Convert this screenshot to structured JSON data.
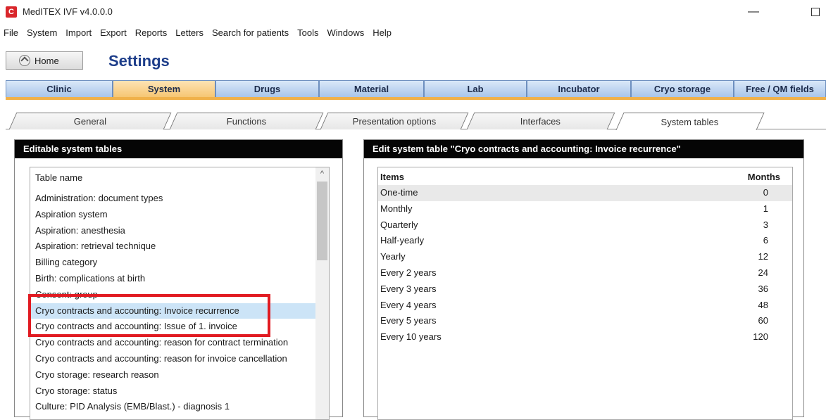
{
  "window": {
    "title": "MedITEX IVF v4.0.0.0",
    "app_icon": "meditex-logo-icon"
  },
  "menu": [
    "File",
    "System",
    "Import",
    "Export",
    "Reports",
    "Letters",
    "Search for patients",
    "Tools",
    "Windows",
    "Help"
  ],
  "header": {
    "home_label": "Home",
    "title": "Settings"
  },
  "main_tabs": [
    "Clinic",
    "System",
    "Drugs",
    "Material",
    "Lab",
    "Incubator",
    "Cryo storage",
    "Free / QM fields"
  ],
  "main_tab_active": "System",
  "sub_tabs": [
    "General",
    "Functions",
    "Presentation options",
    "Interfaces",
    "System tables"
  ],
  "sub_tab_active": "System tables",
  "left_panel": {
    "title": "Editable system tables",
    "column_header": "Table name",
    "rows": [
      "Administration: document types",
      "Aspiration system",
      "Aspiration: anesthesia",
      "Aspiration: retrieval technique",
      "Billing category",
      "Birth: complications at birth",
      "Consent: group",
      "Cryo contracts and accounting: Invoice recurrence",
      "Cryo contracts and accounting: Issue of 1. invoice",
      "Cryo contracts and accounting: reason for contract termination",
      "Cryo contracts and accounting: reason for invoice cancellation",
      "Cryo storage: research reason",
      "Cryo storage: status",
      "Culture: PID Analysis (EMB/Blast.) - diagnosis 1"
    ],
    "selected_row": "Cryo contracts and accounting: Invoice recurrence"
  },
  "right_panel": {
    "title": "Edit system table \"Cryo contracts and accounting: Invoice recurrence\"",
    "columns": [
      "Items",
      "Months"
    ],
    "rows": [
      {
        "item": "One-time",
        "months": "0"
      },
      {
        "item": "Monthly",
        "months": "1"
      },
      {
        "item": "Quarterly",
        "months": "3"
      },
      {
        "item": "Half-yearly",
        "months": "6"
      },
      {
        "item": "Yearly",
        "months": "12"
      },
      {
        "item": "Every 2 years",
        "months": "24"
      },
      {
        "item": "Every 3 years",
        "months": "36"
      },
      {
        "item": "Every 4 years",
        "months": "48"
      },
      {
        "item": "Every 5 years",
        "months": "60"
      },
      {
        "item": "Every 10 years",
        "months": "120"
      }
    ]
  },
  "colors": {
    "highlight_box": "#e11b22",
    "tab_active": "#f6c673",
    "tab_inactive": "#a9c5ea",
    "title_blue": "#1e3e8a",
    "selection": "#cce4f7"
  }
}
